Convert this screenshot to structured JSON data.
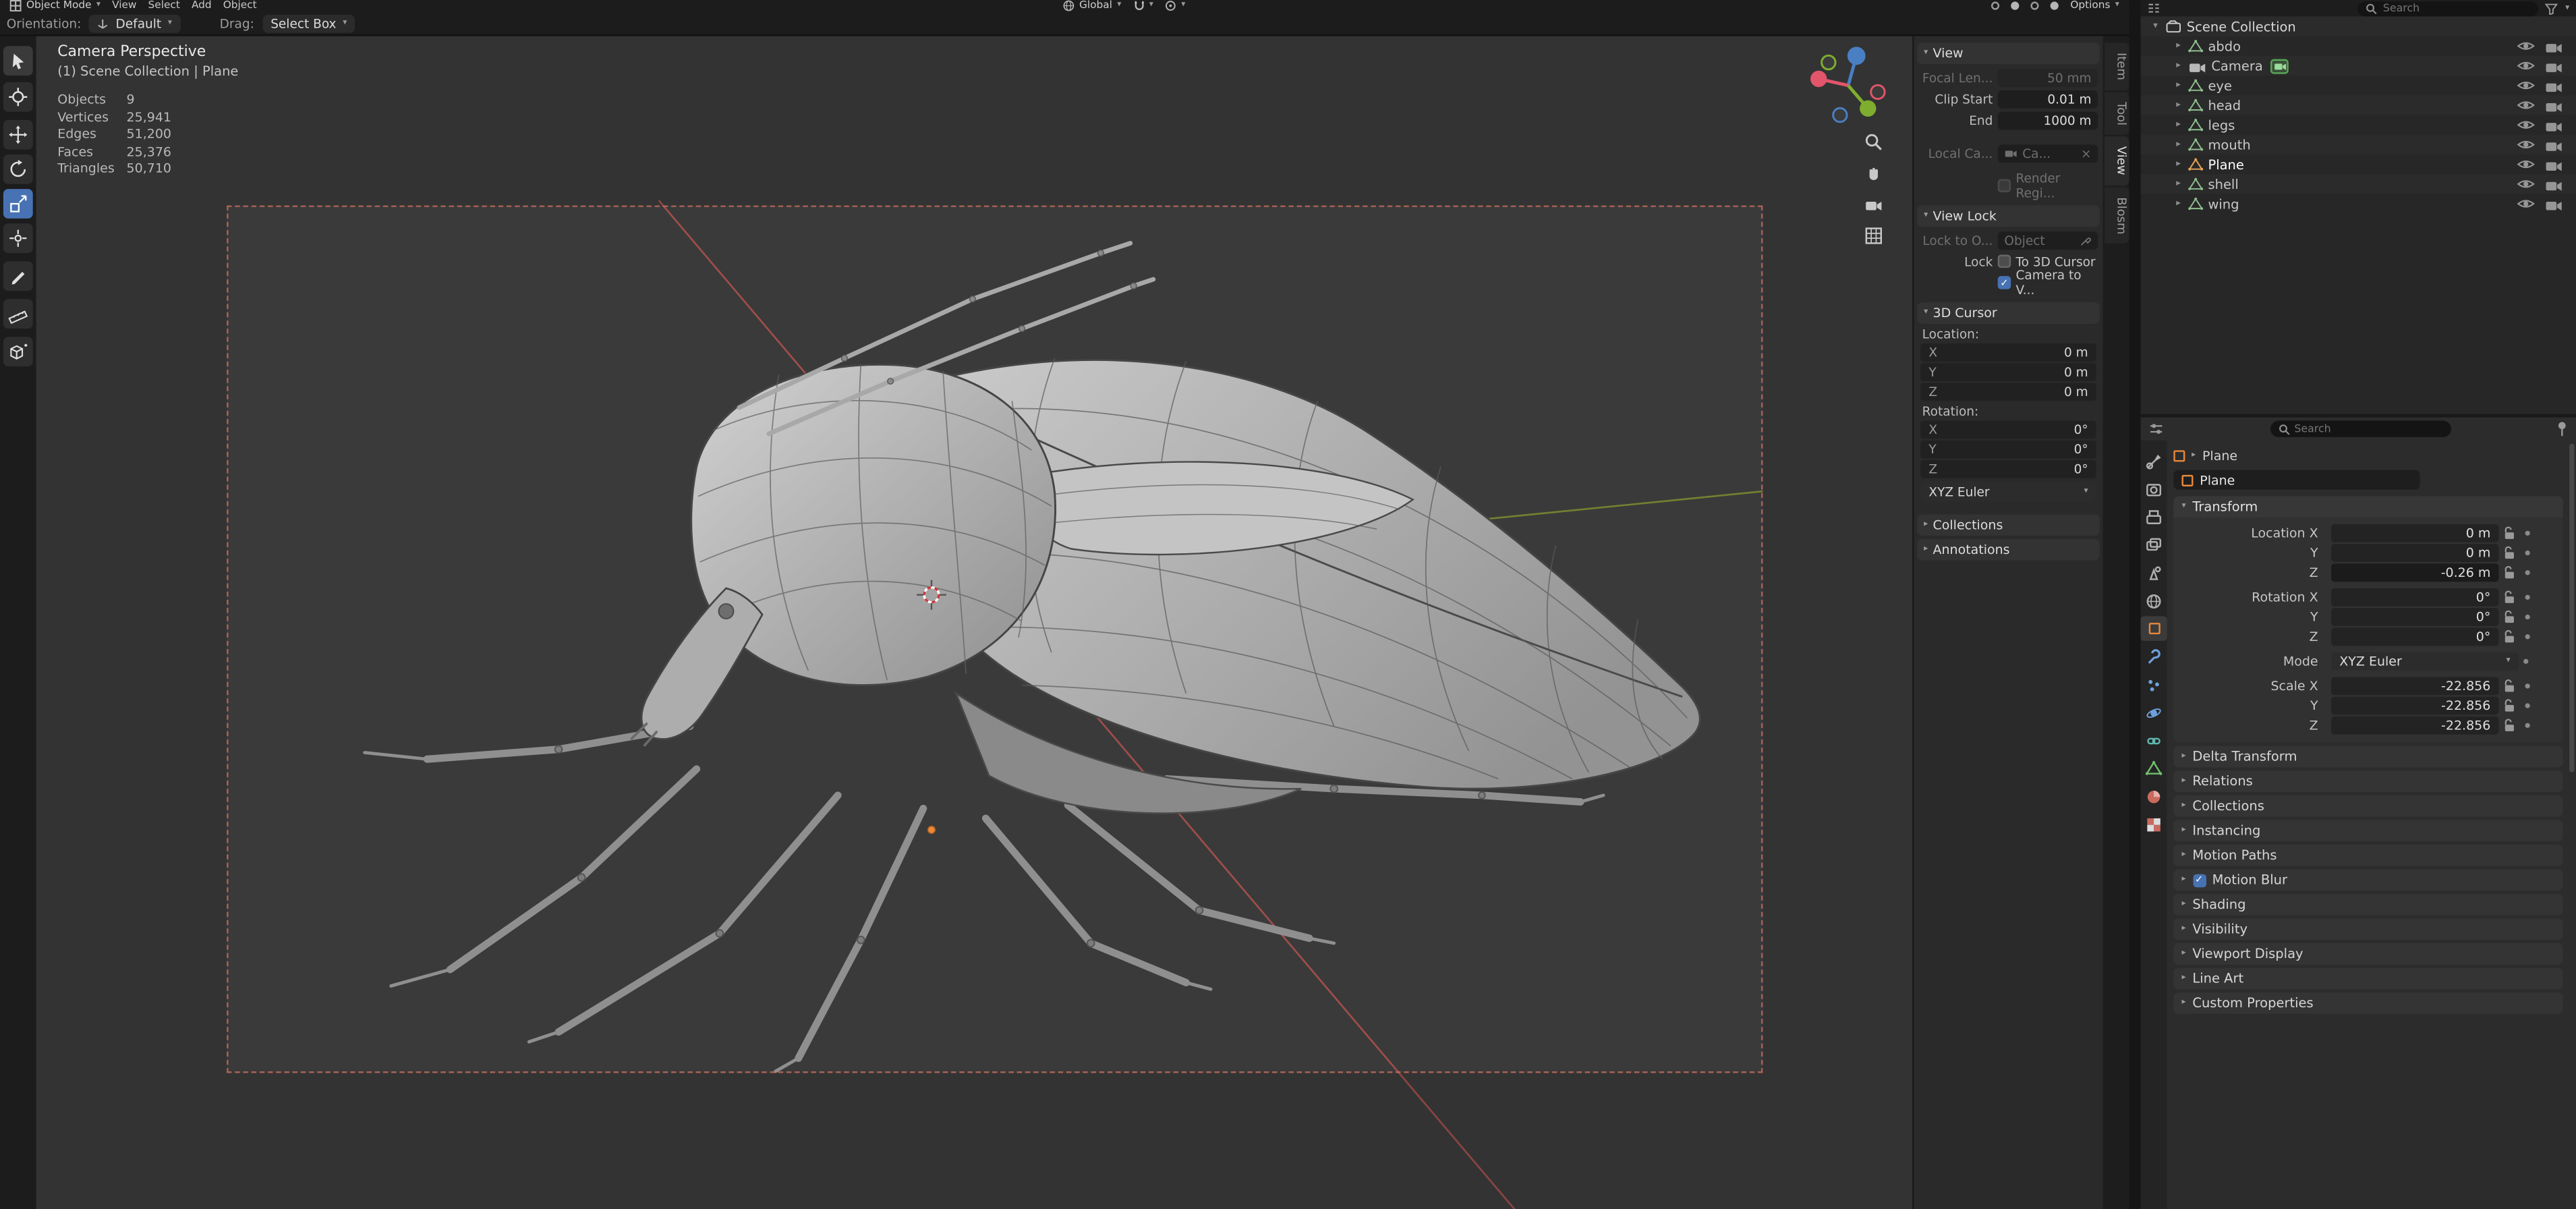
{
  "glyphs": {
    "caret_down": "▾",
    "caret_right": "▸",
    "check": "✓",
    "clear": "×"
  },
  "topbar": {
    "mode": "Object Mode",
    "menus": [
      "View",
      "Select",
      "Add",
      "Object"
    ],
    "orientation_pivot": "Global",
    "options": "Options"
  },
  "tool_settings": {
    "orientation_label": "Orientation:",
    "orientation_value": "Default",
    "drag_label": "Drag:",
    "drag_value": "Select Box"
  },
  "viewport": {
    "view_name": "Camera Perspective",
    "context": "(1) Scene Collection | Plane",
    "stats": [
      {
        "label": "Objects",
        "value": "9"
      },
      {
        "label": "Vertices",
        "value": "25,941"
      },
      {
        "label": "Edges",
        "value": "51,200"
      },
      {
        "label": "Faces",
        "value": "25,376"
      },
      {
        "label": "Triangles",
        "value": "50,710"
      }
    ]
  },
  "sidebar_tabs": {
    "items": [
      "Item",
      "Tool",
      "View",
      "Blosm"
    ],
    "active": "View"
  },
  "n_panel": {
    "view": {
      "title": "View",
      "focal_label": "Focal Len...",
      "focal_value": "50 mm",
      "clip_start_label": "Clip Start",
      "clip_start_value": "0.01 m",
      "clip_end_label": "End",
      "clip_end_value": "1000 m",
      "local_camera_label": "Local Ca...",
      "local_camera_value": "Ca...",
      "render_region_label": "Render Regi..."
    },
    "view_lock": {
      "title": "View Lock",
      "lock_object_label": "Lock to O...",
      "lock_object_value": "Object",
      "lock_label": "Lock",
      "to_cursor_label": "To 3D Cursor",
      "camera_to_view_label": "Camera to V..."
    },
    "cursor": {
      "title": "3D Cursor",
      "location_label": "Location:",
      "loc": [
        {
          "axis": "X",
          "value": "0 m"
        },
        {
          "axis": "Y",
          "value": "0 m"
        },
        {
          "axis": "Z",
          "value": "0 m"
        }
      ],
      "rotation_label": "Rotation:",
      "rot": [
        {
          "axis": "X",
          "value": "0°"
        },
        {
          "axis": "Y",
          "value": "0°"
        },
        {
          "axis": "Z",
          "value": "0°"
        }
      ],
      "rotation_mode": "XYZ Euler"
    },
    "collections_title": "Collections",
    "annotations_title": "Annotations"
  },
  "outliner": {
    "search_placeholder": "Search",
    "root": "Scene Collection",
    "items": [
      {
        "name": "abdo"
      },
      {
        "name": "Camera"
      },
      {
        "name": "eye"
      },
      {
        "name": "head"
      },
      {
        "name": "legs"
      },
      {
        "name": "mouth"
      },
      {
        "name": "Plane"
      },
      {
        "name": "shell"
      },
      {
        "name": "wing"
      }
    ]
  },
  "properties": {
    "search_placeholder": "Search",
    "breadcrumb": "Plane",
    "object_name": "Plane",
    "transform": {
      "title": "Transform",
      "rows": [
        {
          "label": "Location X",
          "value": "0 m"
        },
        {
          "label": "Y",
          "value": "0 m"
        },
        {
          "label": "Z",
          "value": "-0.26 m"
        },
        {
          "label": "Rotation X",
          "value": "0°"
        },
        {
          "label": "Y",
          "value": "0°"
        },
        {
          "label": "Z",
          "value": "0°"
        },
        {
          "label": "Scale X",
          "value": "-22.856"
        },
        {
          "label": "Y",
          "value": "-22.856"
        },
        {
          "label": "Z",
          "value": "-22.856"
        }
      ],
      "mode_label": "Mode",
      "mode_value": "XYZ Euler"
    },
    "panels": [
      {
        "title": "Delta Transform"
      },
      {
        "title": "Relations"
      },
      {
        "title": "Collections"
      },
      {
        "title": "Instancing"
      },
      {
        "title": "Motion Paths"
      },
      {
        "title": "Motion Blur"
      },
      {
        "title": "Shading"
      },
      {
        "title": "Visibility"
      },
      {
        "title": "Viewport Display"
      },
      {
        "title": "Line Art"
      },
      {
        "title": "Custom Properties"
      }
    ]
  },
  "colors": {
    "accent_blue": "#4772b3",
    "object_orange": "#e8883b",
    "axis_red": "#b85450",
    "axis_green": "#7f8c2f"
  }
}
